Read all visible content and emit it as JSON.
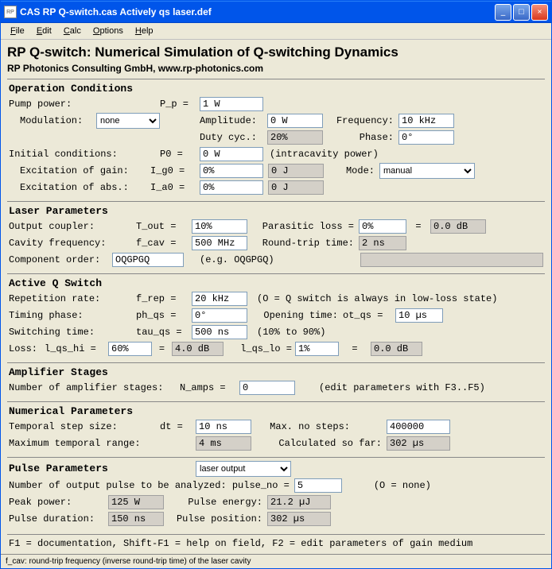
{
  "title": "CAS RP Q-switch.cas Actively qs laser.def",
  "menu": {
    "file": "File",
    "edit": "Edit",
    "calc": "Calc",
    "options": "Options",
    "help": "Help"
  },
  "h1": "RP Q-switch: Numerical Simulation of Q-switching Dynamics",
  "h2": "RP Photonics Consulting GmbH, www.rp-photonics.com",
  "op": {
    "hdr": "Operation Conditions",
    "pump_l": "Pump power:",
    "pump_sym": "P_p =",
    "pump_v": "1 W",
    "mod_l": "Modulation:",
    "mod_v": "none",
    "amp_l": "Amplitude:",
    "amp_v": "0 W",
    "freq_l": "Frequency:",
    "freq_v": "10 kHz",
    "duty_l": "Duty cyc.:",
    "duty_v": "20%",
    "phase_l": "Phase:",
    "phase_v": "0°",
    "init_l": "Initial conditions:",
    "p0": "P0 =",
    "p0_v": "0 W",
    "intra": "(intracavity power)",
    "exg_l": "Excitation of gain:",
    "ig0": "I_g0 =",
    "ig0_v": "0%",
    "ig0_j": "0 J",
    "mode_l": "Mode:",
    "mode_v": "manual",
    "exa_l": "Excitation of abs.:",
    "ia0": "I_a0 =",
    "ia0_v": "0%",
    "ia0_j": "0 J"
  },
  "lp": {
    "hdr": "Laser Parameters",
    "oc_l": "Output coupler:",
    "tout": "T_out =",
    "tout_v": "10%",
    "pl_l": "Parasitic loss =",
    "pl_v": "0%",
    "eq": "=",
    "pl_db": "0.0 dB",
    "cf_l": "Cavity frequency:",
    "fcav": "f_cav =",
    "fcav_v": "500 MHz",
    "rt_l": "Round-trip time:",
    "rt_v": "2 ns",
    "co_l": "Component order:",
    "co_v": "OQGPGQ",
    "co_eg": "(e.g. OQGPGQ)"
  },
  "aq": {
    "hdr": "Active Q Switch",
    "rep_l": "Repetition rate:",
    "frep": "f_rep =",
    "frep_v": "20 kHz",
    "rep_note": "(O = Q switch is always in low-loss state)",
    "tp_l": "Timing phase:",
    "phqs": "ph_qs =",
    "phqs_v": "0°",
    "ot_l": "Opening time:",
    "otqs": "ot_qs =",
    "otqs_v": "10 µs",
    "sw_l": "Switching time:",
    "tauqs": "tau_qs =",
    "tauqs_v": "500 ns",
    "sw_note": "(10% to 90%)",
    "loss_l": "Loss:",
    "lhi": "l_qs_hi =",
    "lhi_v": "60%",
    "eq": "=",
    "lhi_db": "4.0 dB",
    "llo": "l_qs_lo =",
    "llo_v": "1%",
    "llo_db": "0.0 dB"
  },
  "as": {
    "hdr": "Amplifier Stages",
    "l": "Number of amplifier stages:",
    "namps": "N_amps =",
    "namps_v": "0",
    "note": "(edit parameters with F3..F5)"
  },
  "np": {
    "hdr": "Numerical Parameters",
    "ts_l": "Temporal step size:",
    "dt": "dt =",
    "dt_v": "10 ns",
    "mns_l": "Max. no steps:",
    "mns_v": "400000",
    "mtr_l": "Maximum temporal range:",
    "mtr_v": "4 ms",
    "csf_l": "Calculated so far:",
    "csf_v": "302 µs"
  },
  "pp": {
    "hdr": "Pulse Parameters",
    "sel": "laser output",
    "nop_l": "Number of output pulse to be analyzed: pulse_no =",
    "nop_v": "5",
    "nop_note": "(O = none)",
    "pk_l": "Peak power:",
    "pk_v": "125 W",
    "pe_l": "Pulse energy:",
    "pe_v": "21.2 µJ",
    "pd_l": "Pulse duration:",
    "pd_v": "150 ns",
    "ppos_l": "Pulse position:",
    "ppos_v": "302 µs"
  },
  "foot": "F1 = documentation, Shift-F1 = help on field, F2 = edit parameters of gain medium",
  "status": "f_cav: round-trip frequency (inverse round-trip time) of the laser cavity"
}
